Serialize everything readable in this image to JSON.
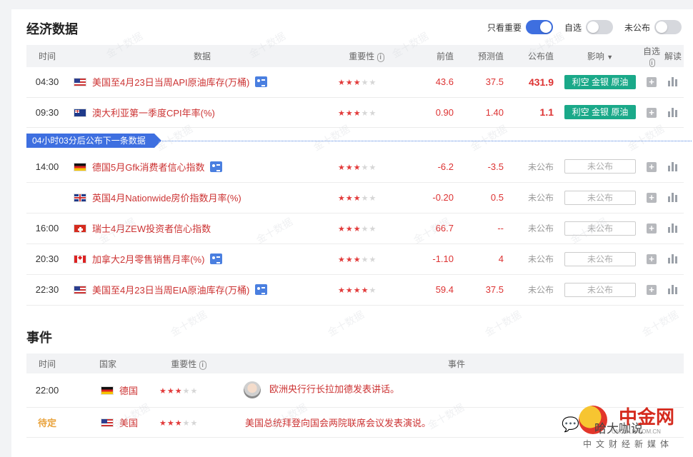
{
  "economic": {
    "title": "经济数据",
    "toggles": [
      {
        "label": "只看重要",
        "on": true
      },
      {
        "label": "自选",
        "on": false
      },
      {
        "label": "未公布",
        "on": false
      }
    ],
    "headers": {
      "time": "时间",
      "data": "数据",
      "importance": "重要性",
      "previous": "前值",
      "forecast": "预测值",
      "actual": "公布值",
      "impact": "影响",
      "watch": "自选",
      "interpret": "解读"
    },
    "next_banner": "04小时03分后公布下一条数据",
    "rows_before": [
      {
        "time": "04:30",
        "flag": "us",
        "name": "美国至4月23日当周API原油库存(万桶)",
        "doc": true,
        "stars": 3,
        "previous": "43.6",
        "forecast": "37.5",
        "actual": "431.9",
        "impact": "利空 金银 原油"
      },
      {
        "time": "09:30",
        "flag": "au",
        "name": "澳大利亚第一季度CPI年率(%)",
        "doc": false,
        "stars": 3,
        "previous": "0.90",
        "forecast": "1.40",
        "actual": "1.1",
        "impact": "利空 金银 原油"
      }
    ],
    "rows_after": [
      {
        "time": "14:00",
        "flag": "de",
        "name": "德国5月Gfk消费者信心指数",
        "doc": true,
        "stars": 3,
        "previous": "-6.2",
        "forecast": "-3.5",
        "actual": "未公布",
        "impact": "未公布"
      },
      {
        "time": "",
        "flag": "gb",
        "name": "英国4月Nationwide房价指数月率(%)",
        "doc": false,
        "stars": 3,
        "previous": "-0.20",
        "forecast": "0.5",
        "actual": "未公布",
        "impact": "未公布"
      },
      {
        "time": "16:00",
        "flag": "ch",
        "name": "瑞士4月ZEW投资者信心指数",
        "doc": false,
        "stars": 3,
        "previous": "66.7",
        "forecast": "--",
        "actual": "未公布",
        "impact": "未公布"
      },
      {
        "time": "20:30",
        "flag": "ca",
        "name": "加拿大2月零售销售月率(%)",
        "doc": true,
        "stars": 3,
        "previous": "-1.10",
        "forecast": "4",
        "actual": "未公布",
        "impact": "未公布"
      },
      {
        "time": "22:30",
        "flag": "us",
        "name": "美国至4月23日当周EIA原油库存(万桶)",
        "doc": true,
        "stars": 4,
        "previous": "59.4",
        "forecast": "37.5",
        "actual": "未公布",
        "impact": "未公布"
      }
    ]
  },
  "events": {
    "title": "事件",
    "headers": {
      "time": "时间",
      "country": "国家",
      "importance": "重要性",
      "event": "事件"
    },
    "rows": [
      {
        "time": "22:00",
        "pending": false,
        "flag": "de",
        "country": "德国",
        "stars": 3,
        "avatar": true,
        "event": "欧洲央行行长拉加德发表讲话。"
      },
      {
        "time": "待定",
        "pending": true,
        "flag": "us",
        "country": "美国",
        "stars": 3,
        "avatar": false,
        "event": "美国总统拜登向国会两院联席会议发表演说。"
      }
    ]
  },
  "watermark": "金十数据",
  "brand": {
    "name": "中金网",
    "sub_en": "CNGOLD.COM.CN",
    "sub_cn": "中文财经新媒体",
    "owner": "哈大咖说"
  },
  "colors": {
    "accent": "#3e6fe0",
    "bearish": "#1aa989",
    "value_red": "#d33",
    "pending": "#e9a23b"
  }
}
